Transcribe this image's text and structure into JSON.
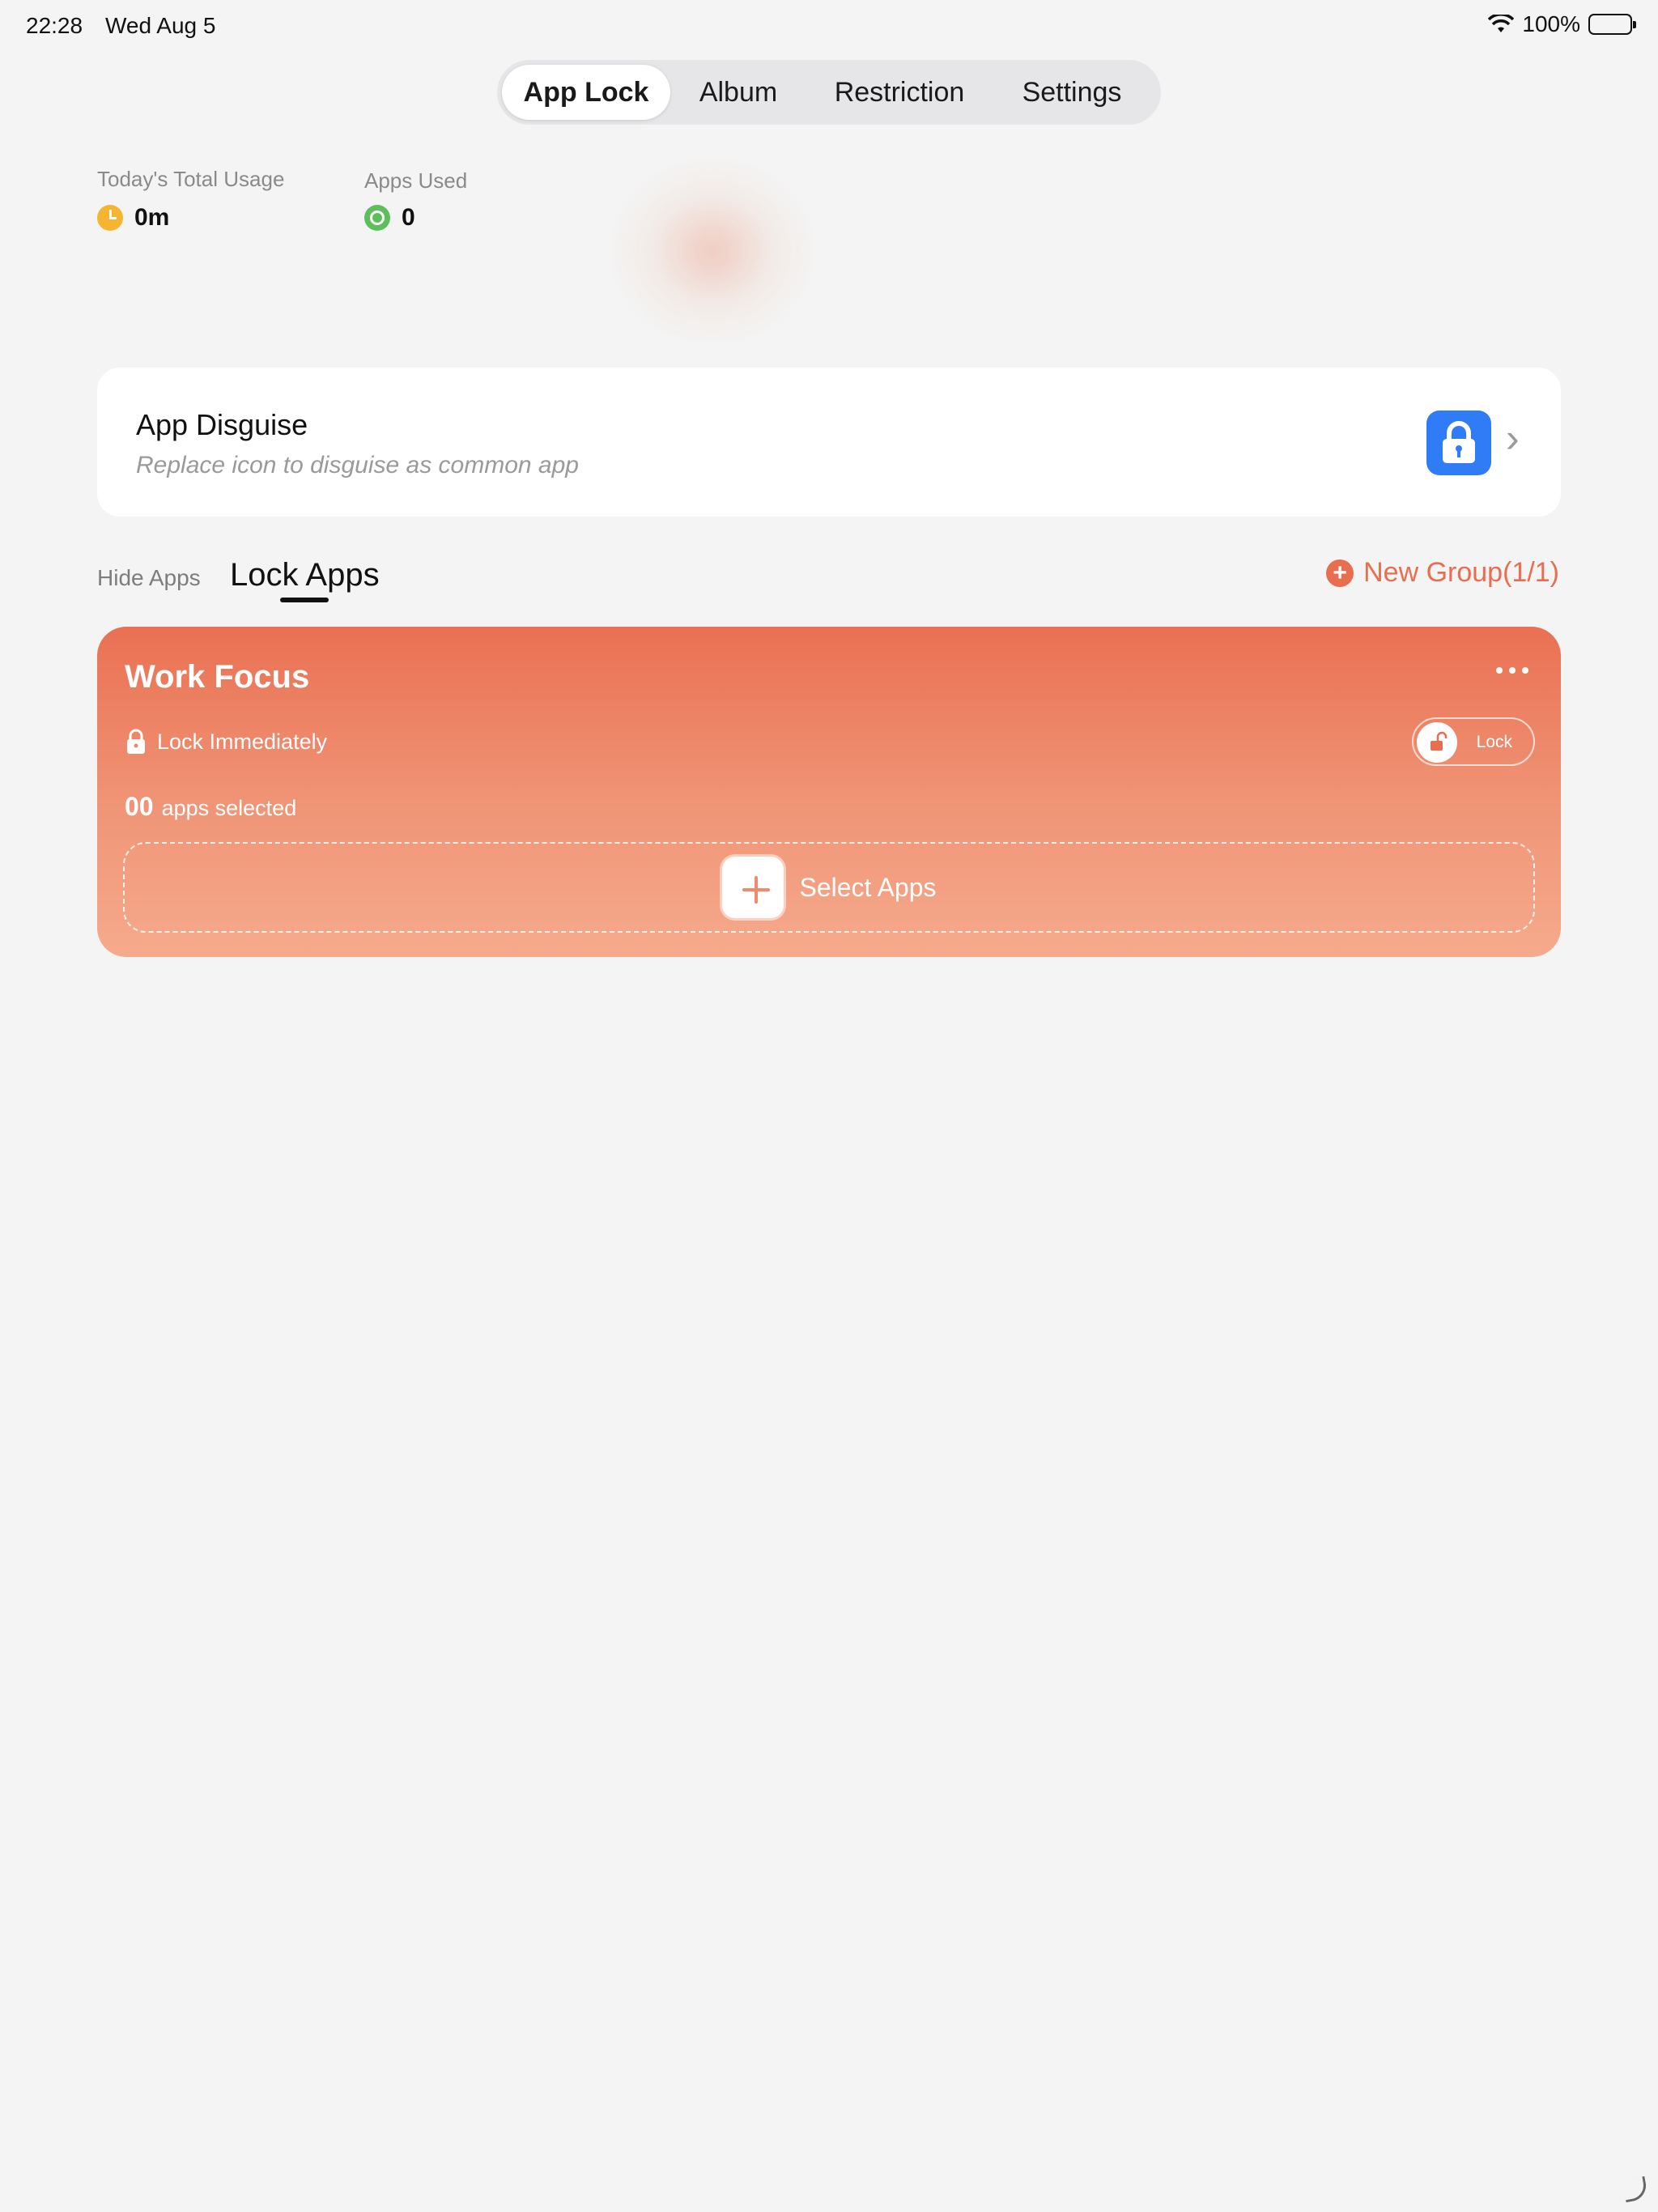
{
  "status_bar": {
    "time": "22:28",
    "date": "Wed Aug 5",
    "battery": "100%"
  },
  "segmented": {
    "tabs": [
      {
        "label": "App Lock",
        "active": true
      },
      {
        "label": "Album",
        "active": false
      },
      {
        "label": "Restriction",
        "active": false
      },
      {
        "label": "Settings",
        "active": false
      }
    ]
  },
  "stats": {
    "usage_label": "Today's Total Usage",
    "usage_value": "0m",
    "apps_label": "Apps Used",
    "apps_value": "0"
  },
  "disguise": {
    "title": "App Disguise",
    "subtitle": "Replace icon to disguise as common app"
  },
  "lists": {
    "hide_tab": "Hide Apps",
    "lock_tab": "Lock Apps",
    "new_group": "New Group(1/1)"
  },
  "group": {
    "title": "Work Focus",
    "lock_mode": "Lock Immediately",
    "toggle_label": "Lock",
    "count": "00",
    "count_suffix": "apps selected",
    "select_label": "Select Apps"
  },
  "colors": {
    "accent": "#e86e4f",
    "card_top": "#ea7052",
    "card_bottom": "#f6aa8c",
    "disguise_icon": "#2f7cf6"
  }
}
